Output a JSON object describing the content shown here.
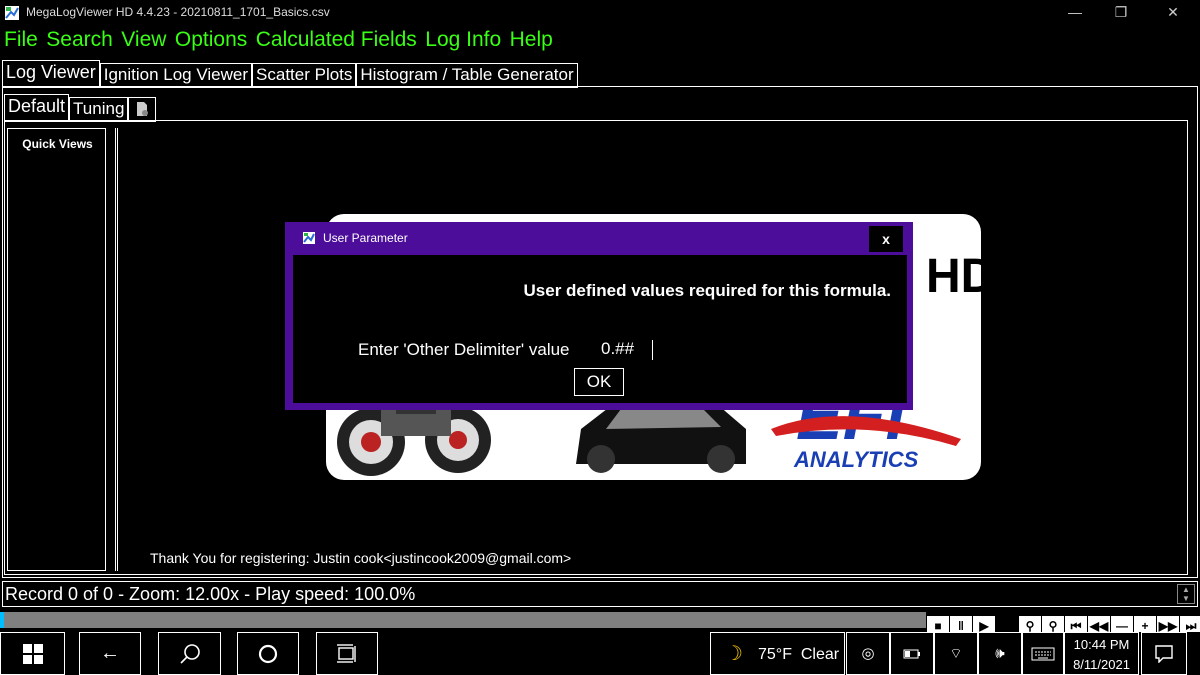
{
  "window": {
    "title": "MegaLogViewer HD 4.4.23 - 20210811_1701_Basics.csv",
    "minimize": "—",
    "maximize": "❐",
    "close": "✕"
  },
  "menu": [
    "File",
    "Search",
    "View",
    "Options",
    "Calculated Fields",
    "Log Info",
    "Help"
  ],
  "main_tabs": [
    "Log Viewer",
    "Ignition Log Viewer",
    "Scatter Plots",
    "Histogram / Table Generator"
  ],
  "sub_tabs": [
    "Default",
    "Tuning"
  ],
  "quick_views": {
    "title": "Quick Views"
  },
  "splash": {
    "logo_letters": "HD",
    "brand_letters": "EFI",
    "brand_name": "ANALYTICS"
  },
  "registration": "Thank You for registering: Justin cook<justincook2009@gmail.com>",
  "dialog": {
    "title": "User Parameter",
    "close_label": "x",
    "heading": "User defined values required for this formula.",
    "field_label": "Enter 'Other Delimiter' value",
    "field_value": "0.##",
    "ok_label": "OK"
  },
  "status": {
    "text": "Record 0 of 0 - Zoom: 12.00x - Play speed: 100.0%"
  },
  "playback": {
    "controls": [
      {
        "name": "stop-button",
        "icon": "■"
      },
      {
        "name": "pause-button",
        "icon": "‖"
      },
      {
        "name": "play-button",
        "icon": "▶"
      },
      {
        "name": "blank-button",
        "icon": ""
      },
      {
        "name": "zoom-out-button",
        "icon": "⚲"
      },
      {
        "name": "zoom-in-button",
        "icon": "⚲"
      },
      {
        "name": "jump-start-button",
        "icon": "⏮"
      },
      {
        "name": "rewind-button",
        "icon": "◀◀"
      },
      {
        "name": "minus-button",
        "icon": "—"
      },
      {
        "name": "plus-button",
        "icon": "+"
      },
      {
        "name": "fast-forward-button",
        "icon": "▶▶"
      },
      {
        "name": "jump-end-button",
        "icon": "⏭"
      }
    ]
  },
  "taskbar": {
    "weather_temp": "75°F",
    "weather_desc": "Clear",
    "time": "10:44 PM",
    "date": "8/11/2021"
  },
  "colors": {
    "menu_green": "#39ff14",
    "dialog_frame": "#4b0d9a",
    "progress_accent": "#00bfff"
  }
}
